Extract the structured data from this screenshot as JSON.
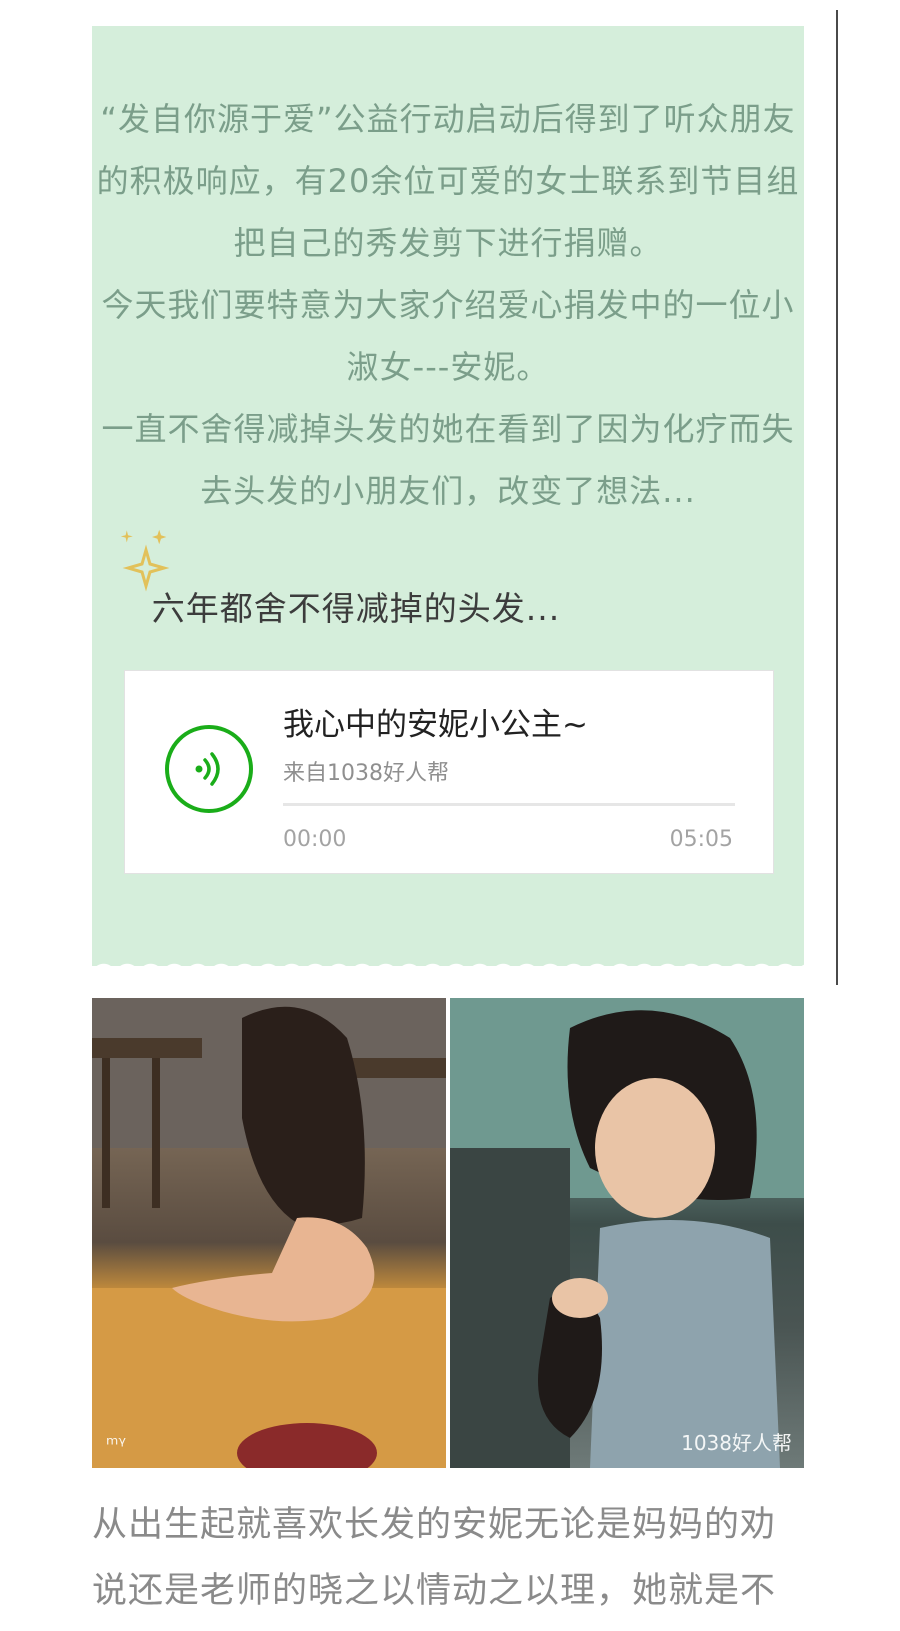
{
  "intro": {
    "paragraphs": [
      "“发自你源于爱”公益行动启动后得到了听众朋友的积极响应，有20余位可爱的女士联系到节目组把自己的秀发剪下进行捐赠。",
      "今天我们要特意为大家介绍爱心捐发中的一位小淑女---安妮。",
      "一直不舍得减掉头发的她在看到了因为化疗而失去头发的小朋友们，改变了想法..."
    ]
  },
  "subheading": "六年都舍不得减掉的头发...",
  "audio": {
    "title": "我心中的安妮小公主~",
    "source": "来自1038好人帮",
    "current_time": "00:00",
    "duration": "05:05",
    "progress": 0,
    "play_icon": "sound-wave-icon"
  },
  "photos": {
    "left_alt": "photo-girl-long-hair-back",
    "right_alt": "photo-girl-short-hair",
    "left_watermark": "ᵐᵞ",
    "right_watermark": "1038好人帮"
  },
  "body": {
    "text": "从出生起就喜欢长发的安妮无论是妈妈的劝说还是老师的晓之以情动之以理，她就是不"
  },
  "colors": {
    "card_bg": "#d5eedb",
    "accent_green": "#1aad19",
    "intro_text": "#7b9e8a",
    "sparkle": "#e2c15a"
  }
}
